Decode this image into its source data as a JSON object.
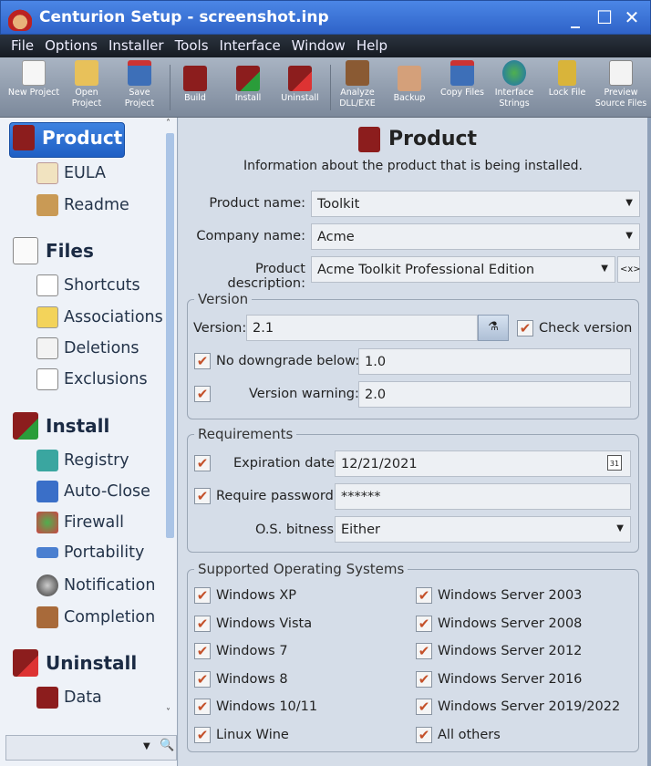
{
  "window": {
    "title": "Centurion Setup - screenshot.inp",
    "minimize": "_",
    "maximize": "☐",
    "close": "✕"
  },
  "menu": [
    "File",
    "Options",
    "Installer",
    "Tools",
    "Interface",
    "Window",
    "Help"
  ],
  "toolbar": [
    {
      "label": "New Project",
      "icon": "new-project-icon"
    },
    {
      "label": "Open Project",
      "icon": "open-project-icon"
    },
    {
      "label": "Save Project",
      "icon": "save-project-icon"
    },
    {
      "label": "Build",
      "icon": "build-icon"
    },
    {
      "label": "Install",
      "icon": "install-icon"
    },
    {
      "label": "Uninstall",
      "icon": "uninstall-icon"
    },
    {
      "label": "Analyze DLL/EXE",
      "icon": "analyze-icon"
    },
    {
      "label": "Backup",
      "icon": "backup-icon"
    },
    {
      "label": "Copy Files",
      "icon": "copy-files-icon"
    },
    {
      "label": "Interface Strings",
      "icon": "globe-icon"
    },
    {
      "label": "Lock File",
      "icon": "lock-icon"
    },
    {
      "label": "Preview Source Files",
      "icon": "preview-icon"
    }
  ],
  "sidebar": {
    "product": "Product",
    "eula": "EULA",
    "readme": "Readme",
    "files": "Files",
    "shortcuts": "Shortcuts",
    "associations": "Associations",
    "deletions": "Deletions",
    "exclusions": "Exclusions",
    "install": "Install",
    "registry": "Registry",
    "autoclose": "Auto-Close",
    "firewall": "Firewall",
    "portability": "Portability",
    "notification": "Notification",
    "completion": "Completion",
    "uninstall": "Uninstall",
    "data": "Data"
  },
  "main": {
    "title": "Product",
    "subtitle": "Information about the product that is being installed.",
    "product_name_label": "Product name:",
    "product_name": "Toolkit",
    "company_name_label": "Company name:",
    "company_name": "Acme",
    "product_desc_label": "Product description:",
    "product_desc": "Acme Toolkit Professional Edition",
    "var_button": "<x>",
    "version": {
      "group": "Version",
      "version_label": "Version:",
      "version": "2.1",
      "check_version": "Check version",
      "check_version_checked": true,
      "no_downgrade_label": "No downgrade below:",
      "no_downgrade": "1.0",
      "no_downgrade_checked": true,
      "warning_label": "Version warning:",
      "warning": "2.0",
      "warning_checked": true
    },
    "requirements": {
      "group": "Requirements",
      "expiration_label": "Expiration date:",
      "expiration": "12/21/2021",
      "expiration_checked": true,
      "calendar": "31",
      "password_label": "Require password:",
      "password": "******",
      "password_checked": true,
      "bitness_label": "O.S. bitness:",
      "bitness": "Either"
    },
    "os": {
      "group": "Supported Operating Systems",
      "items": [
        "Windows XP",
        "Windows Vista",
        "Windows 7",
        "Windows 8",
        "Windows 10/11",
        "Linux Wine",
        "Windows Server 2003",
        "Windows Server 2008",
        "Windows Server 2012",
        "Windows Server 2016",
        "Windows Server 2019/2022",
        "All others"
      ],
      "checked": true
    },
    "check": "✔"
  }
}
